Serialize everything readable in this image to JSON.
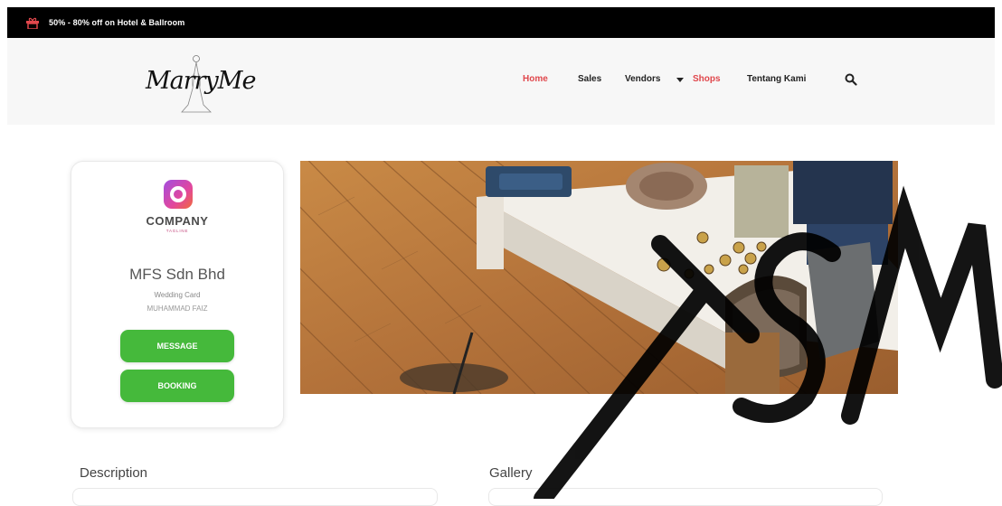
{
  "promo": {
    "text": "50% - 80% off on Hotel & Ballroom",
    "icon": "gift-icon",
    "accent": "#e0474c"
  },
  "header": {
    "logo_text": "MarryMe",
    "nav": {
      "home": "Home",
      "sales": "Sales",
      "vendors": "Vendors",
      "shops": "Shops",
      "about": "Tentang Kami"
    },
    "active_color": "#e0474c",
    "search_icon": "search-icon"
  },
  "profile": {
    "company_logo_name": "COMPANY",
    "company_tagline": "TAGLINE",
    "business_name": "MFS Sdn Bhd",
    "category": "Wedding Card",
    "owner": "MUHAMMAD FAIZ",
    "message_button": "MESSAGE",
    "booking_button": "BOOKING",
    "button_color": "#45b93b"
  },
  "sections": {
    "description": "Description",
    "gallery": "Gallery"
  },
  "watermark_text": "TSM"
}
